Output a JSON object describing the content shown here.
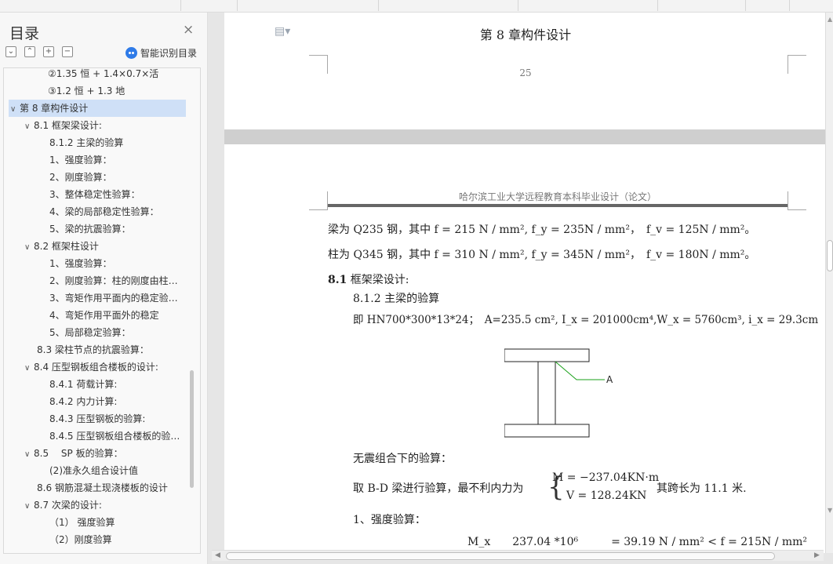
{
  "sidebar": {
    "title": "目录",
    "close": "×",
    "tools": [
      "⌄",
      "⌃",
      "+",
      "−"
    ],
    "smart_toc": "智能识别目录",
    "items": [
      {
        "label": "②1.35 恒 + 1.4×0.7×活",
        "indent": 56,
        "caret": "",
        "selected": false
      },
      {
        "label": "③1.2 恒 + 1.3 地",
        "indent": 56,
        "caret": "",
        "selected": false
      },
      {
        "label": "第 8 章构件设计",
        "indent": 8,
        "caret": "∨",
        "selected": true
      },
      {
        "label": "8.1 框架梁设计:",
        "indent": 26,
        "caret": "∨",
        "selected": false
      },
      {
        "label": "8.1.2 主梁的验算",
        "indent": 58,
        "caret": "",
        "selected": false
      },
      {
        "label": "1、强度验算：",
        "indent": 58,
        "caret": "",
        "selected": false
      },
      {
        "label": "2、刚度验算：",
        "indent": 58,
        "caret": "",
        "selected": false
      },
      {
        "label": "3、整体稳定性验算：",
        "indent": 58,
        "caret": "",
        "selected": false
      },
      {
        "label": "4、梁的局部稳定性验算：",
        "indent": 58,
        "caret": "",
        "selected": false
      },
      {
        "label": "5、梁的抗震验算：",
        "indent": 58,
        "caret": "",
        "selected": false
      },
      {
        "label": "8.2 框架柱设计",
        "indent": 26,
        "caret": "∨",
        "selected": false
      },
      {
        "label": "1、强度验算：",
        "indent": 58,
        "caret": "",
        "selected": false
      },
      {
        "label": "2、刚度验算：柱的刚度由柱…",
        "indent": 58,
        "caret": "",
        "selected": false
      },
      {
        "label": "3、弯矩作用平面内的稳定验…",
        "indent": 58,
        "caret": "",
        "selected": false
      },
      {
        "label": "4、弯矩作用平面外的稳定",
        "indent": 58,
        "caret": "",
        "selected": false
      },
      {
        "label": "5、局部稳定验算：",
        "indent": 58,
        "caret": "",
        "selected": false
      },
      {
        "label": "8.3 梁柱节点的抗震验算：",
        "indent": 42,
        "caret": "",
        "selected": false
      },
      {
        "label": "8.4 压型钢板组合楼板的设计:",
        "indent": 26,
        "caret": "∨",
        "selected": false
      },
      {
        "label": "8.4.1 荷载计算:",
        "indent": 58,
        "caret": "",
        "selected": false
      },
      {
        "label": "8.4.2 内力计算:",
        "indent": 58,
        "caret": "",
        "selected": false
      },
      {
        "label": "8.4.3 压型钢板的验算:",
        "indent": 58,
        "caret": "",
        "selected": false
      },
      {
        "label": "8.4.5 压型钢板组合楼板的验…",
        "indent": 58,
        "caret": "",
        "selected": false
      },
      {
        "label": "8.5　 SP 板的验算：",
        "indent": 26,
        "caret": "∨",
        "selected": false
      },
      {
        "label": "(2)准永久组合设计值",
        "indent": 58,
        "caret": "",
        "selected": false
      },
      {
        "label": "8.6 钢筋混凝土现浇楼板的设计",
        "indent": 42,
        "caret": "",
        "selected": false
      },
      {
        "label": "8.7 次梁的设计:",
        "indent": 26,
        "caret": "∨",
        "selected": false
      },
      {
        "label": "（1） 强度验算",
        "indent": 58,
        "caret": "",
        "selected": false
      },
      {
        "label": "（2）刚度验算",
        "indent": 58,
        "caret": "",
        "selected": false
      }
    ]
  },
  "page1": {
    "header": "第 8 章构件设计",
    "page_number": "25"
  },
  "page2": {
    "header": "哈尔滨工业大学远程教育本科毕业设计（论文）",
    "line_beam": "梁为 Q235 钢，其中 f = 215 N / mm², f_y = 235N / mm²，　f_v = 125N / mm²。",
    "line_column": "柱为 Q345 钢，其中 f = 310 N / mm², f_y = 345N / mm²，　f_v = 180N / mm²。",
    "sec_num": "8.1",
    "sec_title": " 框架梁设计:",
    "subsec": "8.1.2 主梁的验算",
    "section_prop": "即 HN700*300*13*24；　A=235.5 cm², I_x = 201000cm⁴,W_x = 5760cm³, i_x = 29.3cm",
    "beam_label": "A",
    "no_seismic": "无震组合下的验算：",
    "take_bd": "取 B-D 梁进行验算，最不利内力为",
    "moment": "M = −237.04KN·m",
    "shear": "V = 128.24KN",
    "span": "其跨长为 11.1 米.",
    "strength": "1、强度验算：",
    "formula_partial": "M_x　　237.04 *10⁶　　　= 39.19 N / mm² < f = 215N / mm²"
  }
}
